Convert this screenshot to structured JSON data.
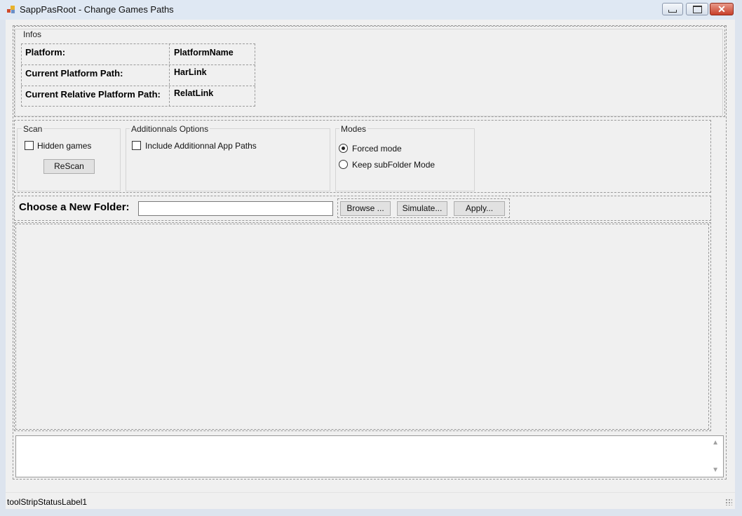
{
  "window": {
    "title": "SappPasRoot - Change Games Paths",
    "close_glyph": "✕"
  },
  "infos": {
    "legend": "Infos",
    "rows": [
      {
        "label": "Platform:",
        "value": "PlatformName"
      },
      {
        "label": "Current Platform Path:",
        "value": "HarLink"
      },
      {
        "label": "Current Relative Platform Path:",
        "value": "RelatLink"
      }
    ]
  },
  "scan": {
    "legend": "Scan",
    "hidden_games_label": "Hidden games",
    "hidden_games_checked": false,
    "rescan_label": "ReScan"
  },
  "additional": {
    "legend": "Additionnals Options",
    "include_label": "Include Additionnal App Paths",
    "include_checked": false
  },
  "modes": {
    "legend": "Modes",
    "options": [
      {
        "label": "Forced mode",
        "selected": true
      },
      {
        "label": "Keep subFolder Mode",
        "selected": false
      }
    ]
  },
  "folder": {
    "label": "Choose a New Folder:",
    "value": "",
    "browse_label": "Browse ...",
    "simulate_label": "Simulate...",
    "apply_label": "Apply..."
  },
  "log": {
    "text": ""
  },
  "status": {
    "label": "toolStripStatusLabel1"
  },
  "icons": [
    "app-icon",
    "minimize-icon",
    "maximize-icon",
    "close-icon",
    "scroll-up-icon",
    "scroll-down-icon",
    "size-grip-icon"
  ]
}
